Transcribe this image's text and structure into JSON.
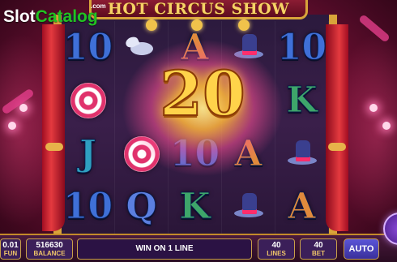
{
  "watermark": {
    "slot": "Slot",
    "catalog": "Catalog",
    "com": ".com"
  },
  "game": {
    "title": "HOT CIRCUS SHOW",
    "win_value": "20"
  },
  "reels": {
    "rows": [
      [
        "10",
        "dove-icon",
        "A",
        "magician-hat-icon",
        "10"
      ],
      [
        "target-icon",
        "",
        "",
        "",
        "K"
      ],
      [
        "J",
        "target-icon",
        "10",
        "A",
        "magician-hat-icon"
      ],
      [
        "10",
        "Q",
        "K",
        "magician-hat-icon",
        "A"
      ]
    ]
  },
  "bottom_bar": {
    "fun_value": "0.01",
    "fun_label": "FUN",
    "balance_value": "516630",
    "balance_label": "BALANCE",
    "win_message": "WIN ON 1 LINE",
    "lines_value": "40",
    "lines_label": "LINES",
    "bet_value": "40",
    "bet_label": "BET",
    "auto_label": "AUTO"
  },
  "colors": {
    "gold": "#d9a43a",
    "win_number": "#ffd34a",
    "watermark_green": "#21c321"
  }
}
